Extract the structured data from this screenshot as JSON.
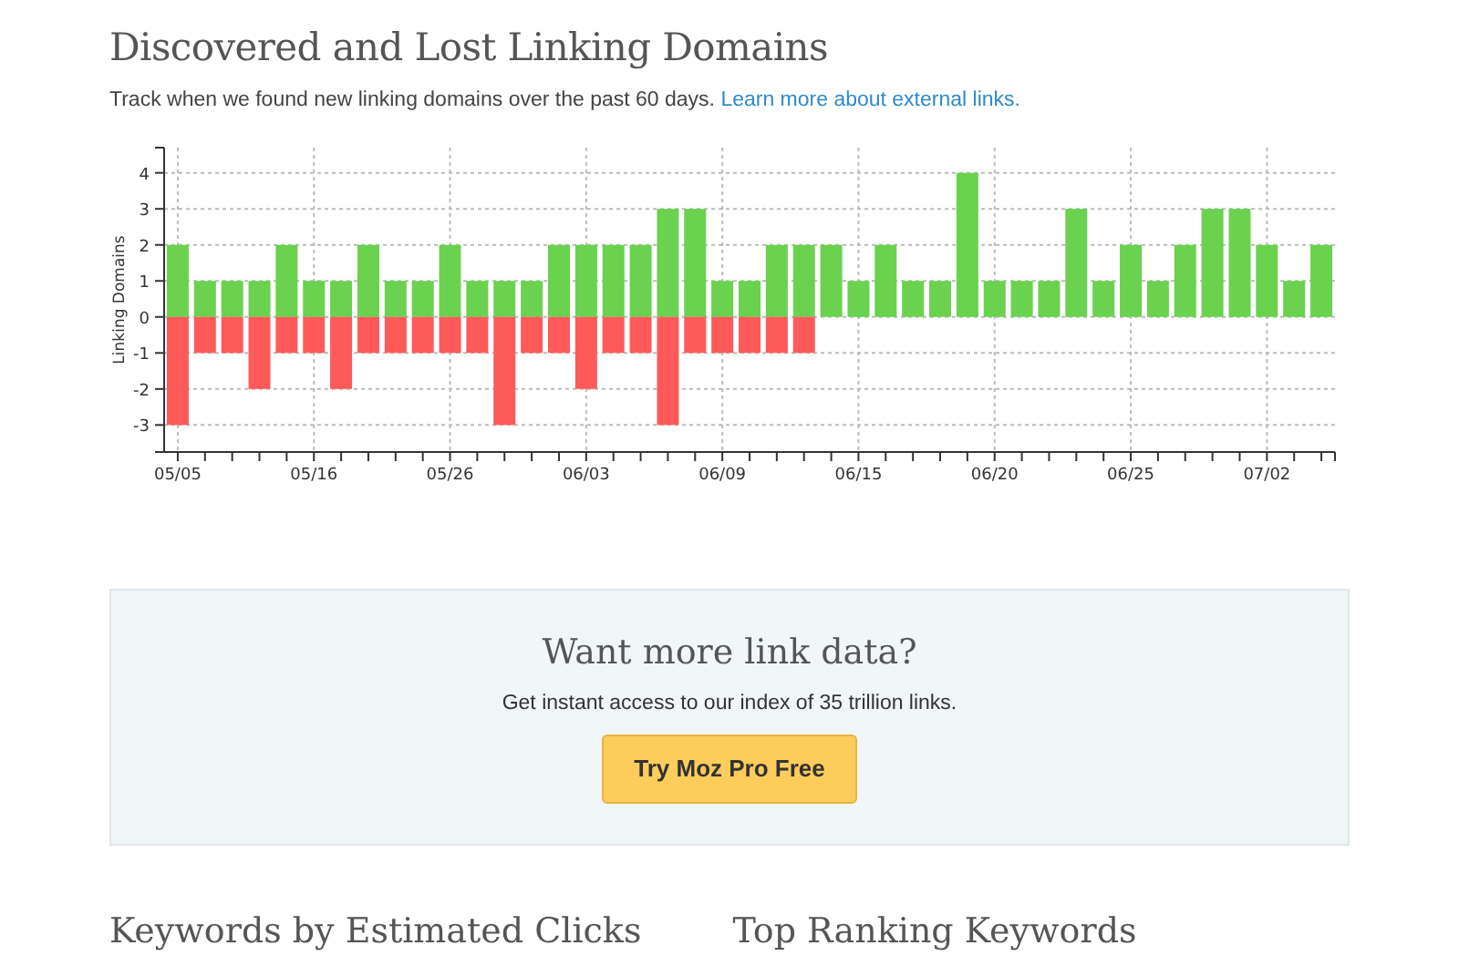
{
  "section": {
    "title": "Discovered and Lost Linking Domains",
    "description": "Track when we found new linking domains over the past 60 days.",
    "link": "Learn more about external links.",
    "chart_data": {
      "type": "bar",
      "ylabel": "Linking Domains",
      "categories": [
        "05/05",
        null,
        null,
        null,
        null,
        "05/16",
        null,
        null,
        null,
        null,
        "05/26",
        null,
        null,
        null,
        null,
        "06/03",
        null,
        null,
        null,
        null,
        "06/09",
        null,
        null,
        null,
        null,
        "06/15",
        null,
        null,
        null,
        null,
        "06/20",
        null,
        null,
        null,
        null,
        "06/25",
        null,
        null,
        null,
        null,
        "07/02",
        null,
        null
      ],
      "series": [
        {
          "color": "#6ad24e",
          "values": [
            2,
            1,
            1,
            1,
            2,
            1,
            1,
            2,
            1,
            1,
            2,
            1,
            1,
            1,
            2,
            2,
            2,
            2,
            3,
            3,
            1,
            1,
            2,
            2,
            2,
            1,
            2,
            1,
            1,
            4,
            1,
            1,
            1,
            3,
            1,
            2,
            1,
            2,
            3,
            3,
            2,
            1,
            2
          ]
        },
        {
          "color": "#ff5a5a",
          "values": [
            -3,
            -1,
            -1,
            -2,
            -1,
            -1,
            -2,
            -1,
            -1,
            -1,
            -1,
            -1,
            -3,
            -1,
            -1,
            -2,
            -1,
            -1,
            -3,
            -1,
            -1,
            -1,
            -1,
            -1,
            0,
            0,
            0,
            0,
            0,
            0,
            0,
            0,
            0,
            0,
            0,
            0,
            0,
            0,
            0,
            0,
            0,
            0,
            0
          ]
        }
      ],
      "stacked": true,
      "grid": true,
      "ylim": [
        -3.75,
        4.7
      ],
      "yticks": [
        -3,
        -2,
        -1,
        0,
        1,
        2,
        3,
        4
      ]
    }
  },
  "promo": {
    "title": "Want more link data?",
    "text": "Get instant access to our index of 35 trillion links.",
    "button": "Try Moz Pro Free"
  },
  "bottom_headings": [
    "Keywords by Estimated Clicks",
    "Top Ranking Keywords"
  ]
}
